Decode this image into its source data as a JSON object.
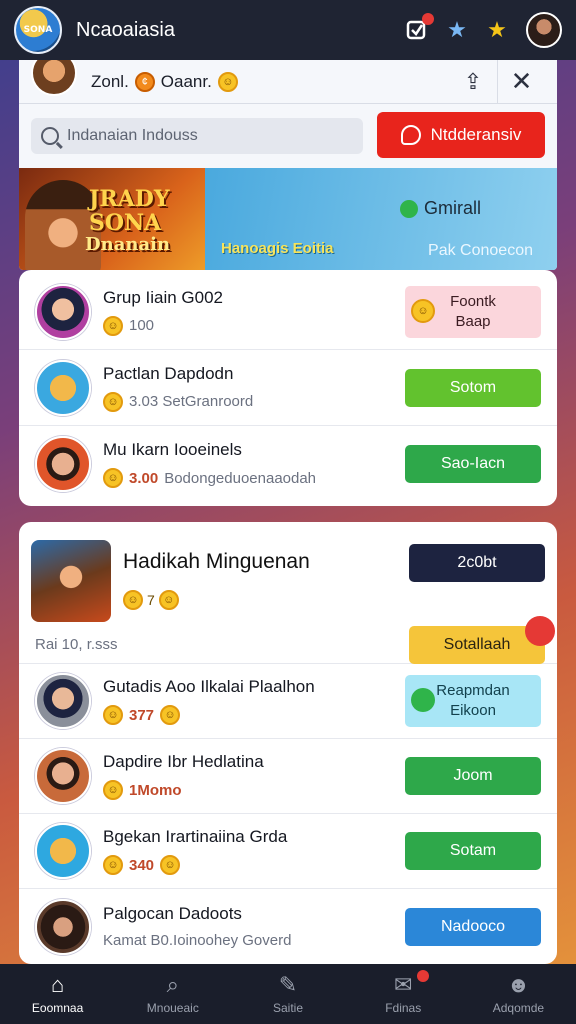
{
  "app": {
    "title": "Ncaoaiasia",
    "logo_text": "SONA",
    "top_icons": [
      "notification-icon",
      "star-outline-icon",
      "star-icon"
    ]
  },
  "modal": {
    "header_text": "Zonl.",
    "header_text2": "Oaanr.",
    "search_placeholder": "Indanaian Indouss",
    "action_button": "Ntdderansiv",
    "banner": {
      "game_title1": "JRADY",
      "game_title2": "SONA",
      "game_title3": "Dnanain",
      "brand": "Gmirall",
      "subtitle": "Hanoagis Eoitia",
      "subtitle2": "Pak Conoecon"
    }
  },
  "list1": [
    {
      "name": "Grup Iiain G002",
      "meta": "100",
      "button": [
        "Foontk",
        "Baap"
      ],
      "style": "pink",
      "avatar_color": "#b03fa0"
    },
    {
      "name": "Pactlan Dapdodn",
      "meta": "3.03 SetGranroord",
      "button": [
        "Sotom"
      ],
      "style": "lime",
      "avatar_color": "#3aa8e0"
    },
    {
      "name": "Mu Ikarn Iooeinels",
      "amount": "3.00",
      "meta": "Bodongeduoenaaodah",
      "button": [
        "Sao-Iacn"
      ],
      "style": "green",
      "avatar_color": "#e0552a"
    }
  ],
  "feature": {
    "title": "Hadikah Minguenan",
    "coins_text": "7",
    "button": "2c0bt",
    "foot_label": "Rai 10, r.sss",
    "foot_button": "Sotallaah"
  },
  "list2": [
    {
      "name": "Gutadis Aoo Ilkalai Plaalhon",
      "meta": "377",
      "button": [
        "Reapmdan",
        "Eikoon"
      ],
      "style": "cyan",
      "avatar_color": "#8a8f9a"
    },
    {
      "name": "Dapdire Ibr Hedlatina",
      "amount": "1Momo",
      "meta": "",
      "button": [
        "Joom"
      ],
      "style": "green",
      "avatar_color": "#c86a3a"
    },
    {
      "name": "Bgekan Irartinaiina Grda",
      "meta": "340",
      "button": [
        "Sotam"
      ],
      "style": "green",
      "avatar_color": "#2ea8e0"
    },
    {
      "name": "Palgocan Dadoots",
      "meta": "Kamat B0.Ioinoohey Goverd",
      "button": [
        "Nadooco"
      ],
      "style": "blue",
      "avatar_color": "#5a3a2a"
    }
  ],
  "nav": [
    {
      "label": "Eoomnaa",
      "icon": "home-icon",
      "glyph": "⌂",
      "active": true
    },
    {
      "label": "Mnoueaic",
      "icon": "search-icon",
      "glyph": "⌕",
      "active": false
    },
    {
      "label": "Saitie",
      "icon": "edit-icon",
      "glyph": "✎",
      "active": false
    },
    {
      "label": "Fdinas",
      "icon": "chat-icon",
      "glyph": "✉",
      "active": false
    },
    {
      "label": "Adqomde",
      "icon": "profile-icon",
      "glyph": "☻",
      "active": false
    }
  ]
}
